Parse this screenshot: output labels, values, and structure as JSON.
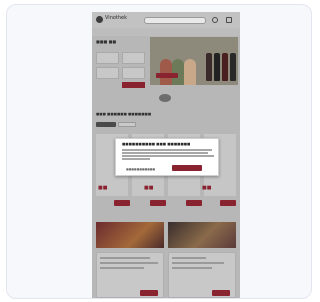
{
  "header": {
    "logo_text": "Vinothek"
  },
  "colors": {
    "accent": "#8a2330",
    "overlay": "#b7b7b7",
    "modal_bg": "#ffffff"
  },
  "icons": [
    "search-icon",
    "account-icon",
    "cart-icon"
  ]
}
